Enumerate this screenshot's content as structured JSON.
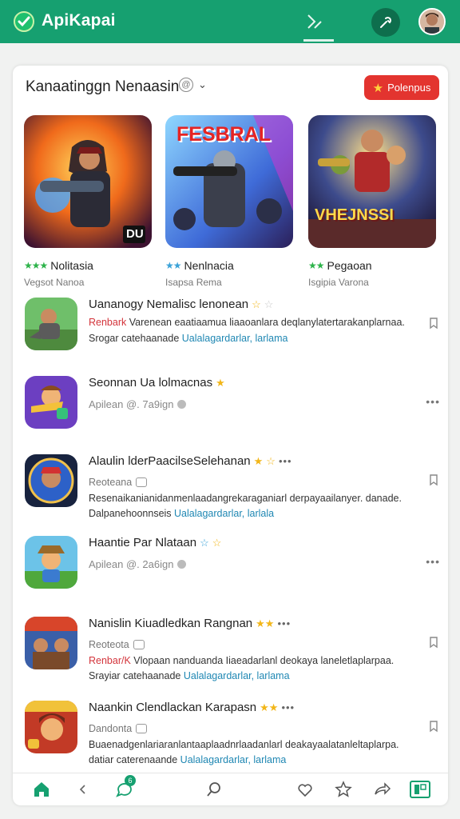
{
  "header": {
    "app_title": "ApiKapai",
    "icons": [
      "check-shield-icon",
      "share-icon",
      "tool-icon",
      "avatar"
    ],
    "brand_color": "#16a070"
  },
  "featured": {
    "title": "Kanaatinggn Nenaasin",
    "promo_label": "Polenpus",
    "items": [
      {
        "name": "Nolitasia",
        "sub": "Vegsot Nanoa",
        "art_text": "DU",
        "stars": "green"
      },
      {
        "name": "Nenlnacia",
        "sub": "Isapsa Rema",
        "art_text": "FESBRAL",
        "stars": "blue"
      },
      {
        "name": "Pegaoan",
        "sub": "Isgipia Varona",
        "art_text": "VHEJNSSI",
        "stars": "green"
      }
    ]
  },
  "list": [
    {
      "title": "Uananogy Nemalisc lenonean",
      "red": "Renbark",
      "line1": " Varenean eaatiaamua liaaoanlara deqlanylatertarakanplarnaa.",
      "line2a": "Srogar catehaanade ",
      "line2b": "Ualalagardarlar, larlama"
    },
    {
      "title": "Seonnan Ua lolmacnas",
      "meta": "Apilean @. 7a9ign"
    },
    {
      "title": "Alaulin lderPaacilseSelehanan",
      "meta_label": "Reoteana",
      "line3": "Resenaikanianidanmenlaadangrekaraganiarl derpayaailanyer. danade.",
      "line4a": "Dalpanehoonnseis ",
      "line4b": "Ualalagardarlar, larlala"
    },
    {
      "title": "Haantie Par Nlataan",
      "meta": "Apilean @. 2a6ign"
    },
    {
      "title": "Nanislin Kiuadledkan Rangnan",
      "meta_label": "Reoteota",
      "red": "Renbar/K",
      "line3": " Vlopaan nanduanda Iiaeadarlanl deokaya laneletlaplarpaa.",
      "line4a": "Srayiar catehaanade ",
      "line4b": "Ualalagardarlar, larlama"
    },
    {
      "title": "Naankin Clendlackan Karapasn",
      "meta_label": "Dandonta",
      "line3": "Buaenadgenlariaranlantaaplaadnrlaadanlarl deakayaalatanleltaplarpa.",
      "line4a": "datiar caterenaande ",
      "line4b": "Ualalagardarlar, larlama"
    }
  ],
  "bottom_nav": [
    "home-icon",
    "back-icon",
    "chat-icon",
    "search-icon",
    "heart-icon",
    "star-icon",
    "share-icon",
    "grid-icon"
  ],
  "chat_badge": "6"
}
